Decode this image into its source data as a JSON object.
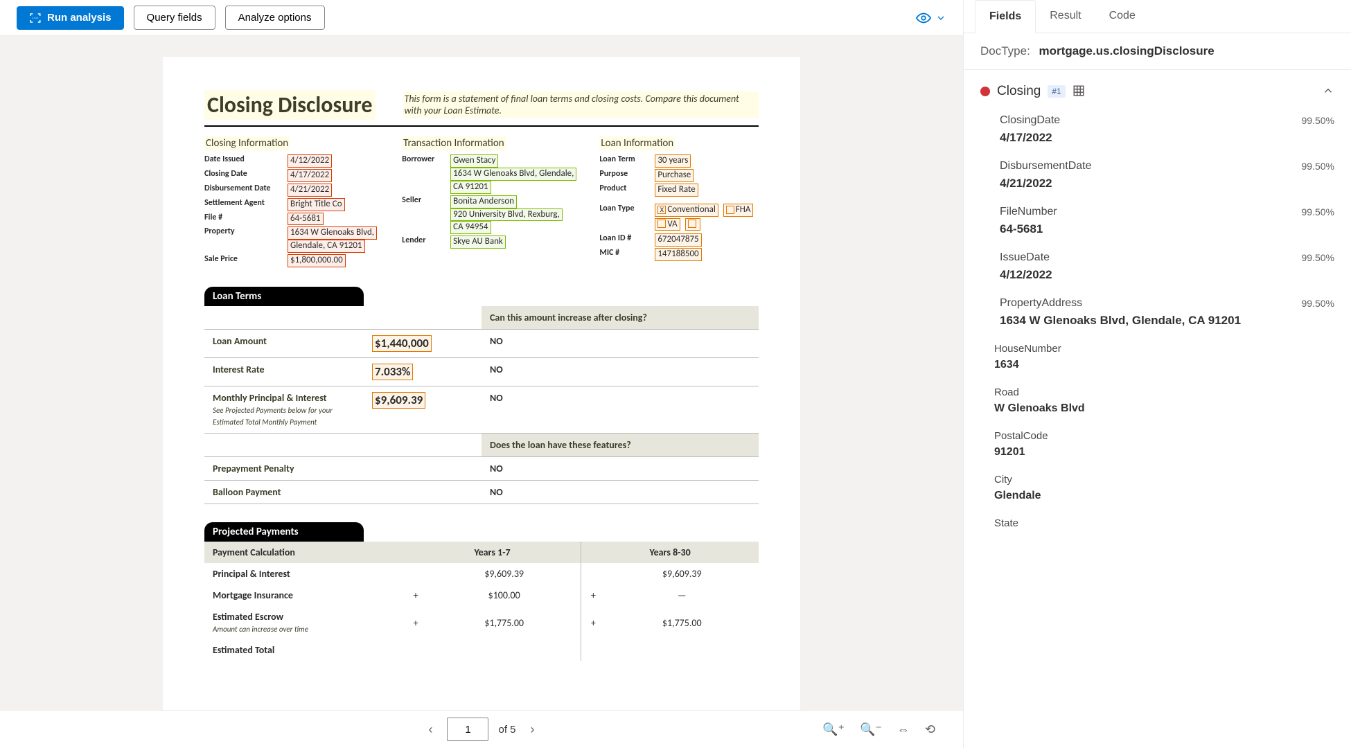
{
  "toolbar": {
    "run": "Run analysis",
    "query": "Query fields",
    "analyze": "Analyze options"
  },
  "document": {
    "title": "Closing Disclosure",
    "subtitle": "This form is a statement of final loan terms and closing costs. Compare this document with your Loan Estimate.",
    "closingInfo": {
      "heading": "Closing  Information",
      "dateIssuedLabel": "Date Issued",
      "dateIssued": "4/12/2022",
      "closingDateLabel": "Closing Date",
      "closingDate": "4/17/2022",
      "disbursementDateLabel": "Disbursement Date",
      "disbursementDate": "4/21/2022",
      "settlementAgentLabel": "Settlement Agent",
      "settlementAgent": "Bright  Title Co",
      "fileLabel": "File #",
      "fileNum": "64-5681",
      "propertyLabel": "Property",
      "property1": "1634 W Glenoaks Blvd,",
      "property2": "Glendale, CA 91201",
      "salePriceLabel": "Sale Price",
      "salePrice": "$1,800,000.00"
    },
    "transactionInfo": {
      "heading": "Transaction  Information",
      "borrowerLabel": "Borrower",
      "borrower1": "Gwen Stacy",
      "borrower2": "1634 W Glenoaks Blvd, Glendale,",
      "borrower3": "CA 91201",
      "sellerLabel": "Seller",
      "seller1": "Bonita Anderson",
      "seller2": "920 University Blvd, Rexburg,",
      "seller3": "CA 94954",
      "lenderLabel": "Lender",
      "lender": "Skye AU Bank"
    },
    "loanInfo": {
      "heading": "Loan  Information",
      "loanTermLabel": "Loan Term",
      "loanTerm": "30 years",
      "purposeLabel": "Purpose",
      "purpose": "Purchase",
      "productLabel": "Product",
      "product": "Fixed Rate",
      "loanTypeLabel": "Loan Type",
      "lt1": "Conventional",
      "lt2": "FHA",
      "lt3": "VA",
      "loanIdLabel": "Loan ID #",
      "loanId": "672047875",
      "micLabel": "MIC #",
      "mic": "147188500"
    },
    "loanTerms": {
      "sectionTitle": "Loan Terms",
      "q1": "Can this amount increase after closing?",
      "r1Label": "Loan Amount",
      "r1Val": "$1,440,000",
      "r1Ans": "NO",
      "r2Label": "Interest Rate",
      "r2Val": "7.033%",
      "r2Ans": "NO",
      "r3Label": "Monthly Principal & Interest",
      "r3Val": "$9,609.39",
      "r3Ans": "NO",
      "r3Note": "See Projected Payments below for your Estimated Total Monthly Payment",
      "q2": "Does the loan have these features?",
      "r4Label": "Prepayment Penalty",
      "r4Ans": "NO",
      "r5Label": "Balloon Payment",
      "r5Ans": "NO"
    },
    "projected": {
      "sectionTitle": "Projected Payments",
      "calcLabel": "Payment Calculation",
      "col1": "Years 1-7",
      "col2": "Years 8-30",
      "r1": "Principal & Interest",
      "r1c1": "$9,609.39",
      "r1c2": "$9,609.39",
      "r2": "Mortgage Insurance",
      "r2c1": "$100.00",
      "r2c2": "—",
      "r3": "Estimated Escrow",
      "r3c1": "$1,775.00",
      "r3c2": "$1,775.00",
      "r3Note": "Amount can increase over time",
      "r4": "Estimated Total"
    }
  },
  "pager": {
    "current": "1",
    "total": "of 5"
  },
  "rightPanel": {
    "tabs": {
      "fields": "Fields",
      "result": "Result",
      "code": "Code"
    },
    "docTypeLabel": "DocType:",
    "docType": "mortgage.us.closingDisclosure",
    "group": {
      "name": "Closing",
      "badge": "#1"
    },
    "fields": [
      {
        "name": "ClosingDate",
        "conf": "99.50%",
        "val": "4/17/2022"
      },
      {
        "name": "DisbursementDate",
        "conf": "99.50%",
        "val": "4/21/2022"
      },
      {
        "name": "FileNumber",
        "conf": "99.50%",
        "val": "64-5681"
      },
      {
        "name": "IssueDate",
        "conf": "99.50%",
        "val": "4/12/2022"
      },
      {
        "name": "PropertyAddress",
        "conf": "99.50%",
        "val": "1634 W Glenoaks Blvd, Glendale, CA 91201"
      }
    ],
    "subfields": [
      {
        "name": "HouseNumber",
        "val": "1634"
      },
      {
        "name": "Road",
        "val": "W Glenoaks Blvd"
      },
      {
        "name": "PostalCode",
        "val": "91201"
      },
      {
        "name": "City",
        "val": "Glendale"
      },
      {
        "name": "State",
        "val": ""
      }
    ]
  }
}
